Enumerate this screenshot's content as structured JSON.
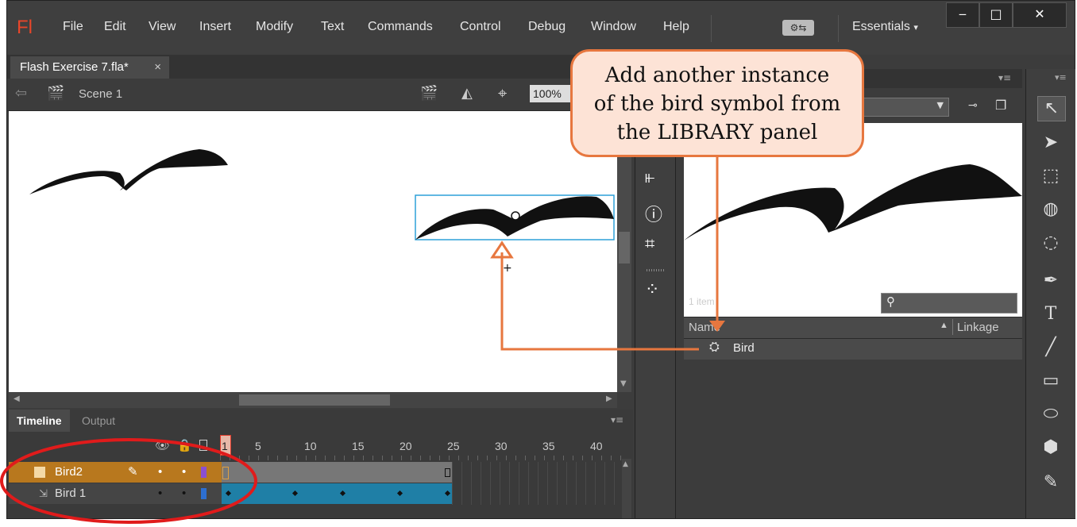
{
  "app": {
    "logo": "Fl",
    "menu": [
      "File",
      "Edit",
      "View",
      "Insert",
      "Modify",
      "Text",
      "Commands",
      "Control",
      "Debug",
      "Window",
      "Help"
    ],
    "workspace": "Essentials",
    "window_controls": {
      "minimize": "‒",
      "maximize": "□",
      "close": "✕"
    }
  },
  "document": {
    "tab_title": "Flash Exercise 7.fla*",
    "tab_close": "×",
    "scene": "Scene 1",
    "zoom": "100%"
  },
  "timeline": {
    "tabs": [
      "Timeline",
      "Output"
    ],
    "frame_numbers": [
      "1",
      "5",
      "10",
      "15",
      "20",
      "25",
      "30",
      "35",
      "40"
    ],
    "layers": [
      {
        "name": "Bird2",
        "selected": true
      },
      {
        "name": "Bird 1",
        "selected": false
      }
    ]
  },
  "library": {
    "item_count": "1 item",
    "columns": {
      "name": "Name",
      "linkage": "Linkage"
    },
    "items": [
      {
        "name": "Bird"
      }
    ]
  },
  "callout": {
    "text_lines": [
      "Add another instance",
      "of the bird symbol from",
      "the LIBRARY panel"
    ]
  },
  "colors": {
    "accent_orange": "#e7773f",
    "highlight_red": "#e01b1b",
    "selection_blue": "#2da0d8",
    "layer_selected": "#b8781e",
    "frames_blue": "#1f7fa6"
  }
}
